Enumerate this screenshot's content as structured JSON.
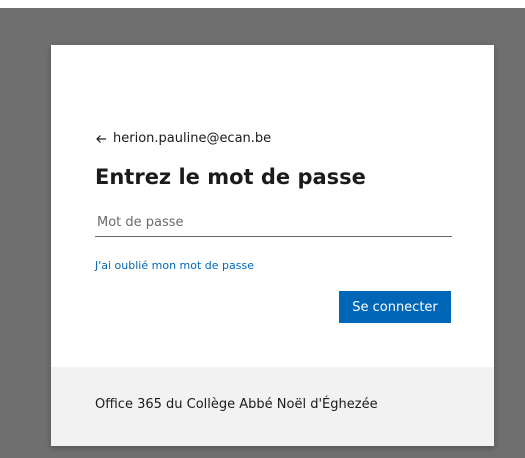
{
  "login": {
    "account_email": "herion.pauline@ecan.be",
    "title": "Entrez le mot de passe",
    "password_placeholder": "Mot de passe",
    "forgot_password": "J'ai oublié mon mot de passe",
    "signin_label": "Se connecter"
  },
  "footer": {
    "organization": "Office 365 du Collège Abbé Noël d'Éghezée"
  },
  "colors": {
    "accent": "#0067b8",
    "backdrop": "#6f6f6f",
    "footer_bg": "#f2f2f2"
  },
  "icons": {
    "back": "arrow-left-icon"
  }
}
